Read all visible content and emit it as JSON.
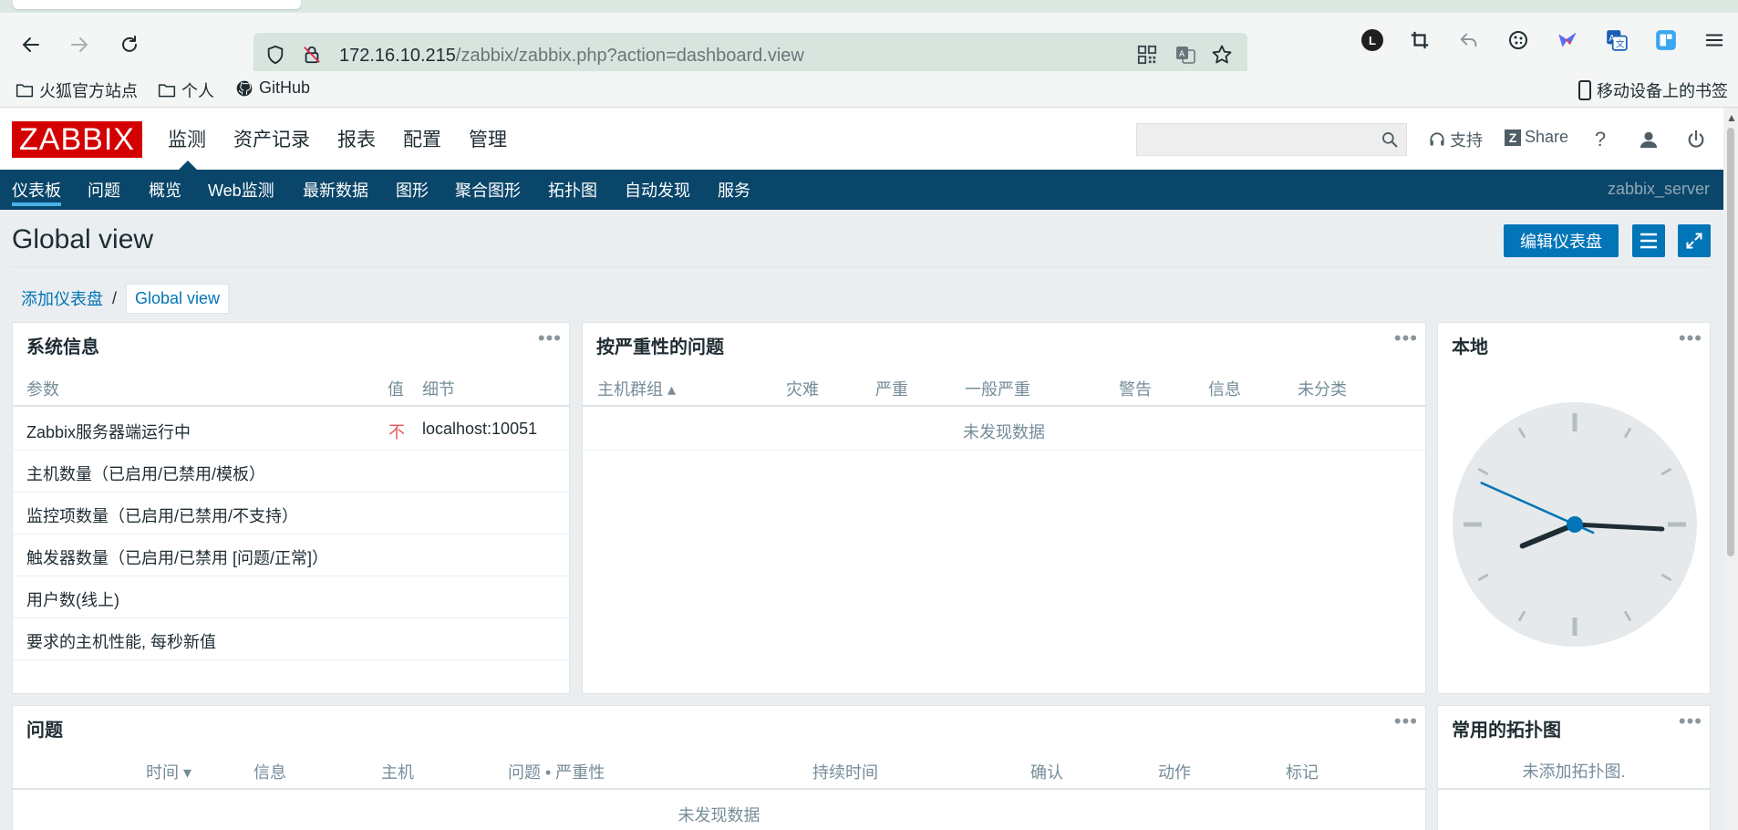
{
  "browser": {
    "url_host": "172.16.10.215",
    "url_path": "/zabbix/zabbix.php?action=dashboard.view",
    "bookmarks": [
      "火狐官方站点",
      "个人",
      "GitHub"
    ],
    "mobile_bookmarks": "移动设备上的书签",
    "profile_initial": "L"
  },
  "header": {
    "logo": "ZABBIX",
    "menu": [
      "监测",
      "资产记录",
      "报表",
      "配置",
      "管理"
    ],
    "support": "支持",
    "share": "Share",
    "help": "?"
  },
  "submenu": {
    "items": [
      "仪表板",
      "问题",
      "概览",
      "Web监测",
      "最新数据",
      "图形",
      "聚合图形",
      "拓扑图",
      "自动发现",
      "服务"
    ],
    "server": "zabbix_server"
  },
  "page": {
    "title": "Global view",
    "edit_button": "编辑仪表盘"
  },
  "breadcrumb": {
    "parent": "添加仪表盘",
    "separator": "/",
    "current": "Global view"
  },
  "sysinfo": {
    "title": "系统信息",
    "headers": [
      "参数",
      "值",
      "细节"
    ],
    "rows": [
      {
        "param": "Zabbix服务器端运行中",
        "value": "不",
        "detail": "localhost:10051"
      },
      {
        "param": "主机数量（已启用/已禁用/模板）",
        "value": "",
        "detail": ""
      },
      {
        "param": "监控项数量（已启用/已禁用/不支持）",
        "value": "",
        "detail": ""
      },
      {
        "param": "触发器数量（已启用/已禁用 [问题/正常]）",
        "value": "",
        "detail": ""
      },
      {
        "param": "用户数(线上)",
        "value": "",
        "detail": ""
      },
      {
        "param": "要求的主机性能, 每秒新值",
        "value": "",
        "detail": ""
      }
    ]
  },
  "severity": {
    "title": "按严重性的问题",
    "headers": [
      "主机群组 ▴",
      "灾难",
      "严重",
      "一般严重",
      "警告",
      "信息",
      "未分类"
    ],
    "empty": "未发现数据"
  },
  "clock": {
    "title": "本地",
    "hour": 8,
    "minute": 15.5,
    "second": 49
  },
  "problems": {
    "title": "问题",
    "headers": [
      "时间 ▾",
      "信息",
      "主机",
      "问题 • 严重性",
      "持续时间",
      "确认",
      "动作",
      "标记"
    ],
    "empty": "未发现数据"
  },
  "maps": {
    "title": "常用的拓扑图",
    "empty": "未添加拓扑图."
  },
  "colors": {
    "brand": "#d40000",
    "nav": "#0a466a",
    "primary": "#0275b8",
    "alert": "#e45959"
  }
}
